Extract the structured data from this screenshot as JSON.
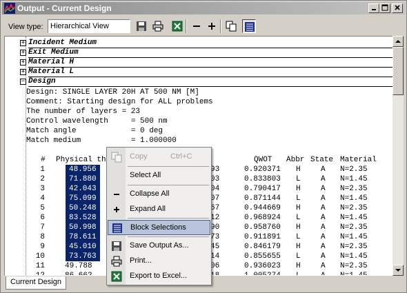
{
  "window": {
    "title": "Output - Current Design"
  },
  "toolbar": {
    "view_type_label": "View type:",
    "view_type_value": "Hierarchical View"
  },
  "sections": [
    {
      "label": "Incident Medium",
      "expanded": false
    },
    {
      "label": "Exit Medium",
      "expanded": false
    },
    {
      "label": "Material H",
      "expanded": false
    },
    {
      "label": "Material L",
      "expanded": false
    },
    {
      "label": "Design",
      "expanded": true
    }
  ],
  "design": {
    "lines": [
      "Design: SINGLE LAYER 20H AT 500 NM [M]",
      "Comment: Starting design for ALL problems",
      "The number of layers = 23",
      "Control wavelength     = 500 nm",
      "Match angle            = 0 deg",
      "Match medium           = 1.000000"
    ],
    "columns": [
      "#",
      "Physical th",
      "QWOT",
      "Abbr",
      "State",
      "Material"
    ],
    "rows": [
      {
        "n": "1",
        "thick": "48.956",
        "frag": "93",
        "qwot": "0.920371",
        "abbr": "H",
        "state": "A",
        "mat": "N=2.35"
      },
      {
        "n": "2",
        "thick": "71.880",
        "frag": "03",
        "qwot": "0.833803",
        "abbr": "L",
        "state": "A",
        "mat": "N=1.45"
      },
      {
        "n": "3",
        "thick": "42.043",
        "frag": "04",
        "qwot": "0.790417",
        "abbr": "H",
        "state": "A",
        "mat": "N=2.35"
      },
      {
        "n": "4",
        "thick": "75.099",
        "frag": "07",
        "qwot": "0.871144",
        "abbr": "L",
        "state": "A",
        "mat": "N=1.45"
      },
      {
        "n": "5",
        "thick": "50.248",
        "frag": "67",
        "qwot": "0.944669",
        "abbr": "H",
        "state": "A",
        "mat": "N=2.35"
      },
      {
        "n": "6",
        "thick": "83.528",
        "frag": "12",
        "qwot": "0.968924",
        "abbr": "L",
        "state": "A",
        "mat": "N=1.45"
      },
      {
        "n": "7",
        "thick": "50.998",
        "frag": "90",
        "qwot": "0.958760",
        "abbr": "H",
        "state": "A",
        "mat": "N=2.35"
      },
      {
        "n": "8",
        "thick": "78.611",
        "frag": "73",
        "qwot": "0.911891",
        "abbr": "L",
        "state": "A",
        "mat": "N=1.45"
      },
      {
        "n": "9",
        "thick": "45.010",
        "frag": "45",
        "qwot": "0.846179",
        "abbr": "H",
        "state": "A",
        "mat": "N=2.35"
      },
      {
        "n": "10",
        "thick": "73.763",
        "frag": "14",
        "qwot": "0.855655",
        "abbr": "L",
        "state": "A",
        "mat": "N=1.45"
      },
      {
        "n": "11",
        "thick": "49.788",
        "frag": "06",
        "qwot": "0.936023",
        "abbr": "H",
        "state": "A",
        "mat": "N=2.35"
      },
      {
        "n": "12",
        "thick": "86.662",
        "frag": "18",
        "qwot": "1.005274",
        "abbr": "L",
        "state": "A",
        "mat": "N=1.45"
      }
    ],
    "selected_rows": 10
  },
  "context_menu": {
    "items": [
      {
        "label": "Copy",
        "shortcut": "Ctrl+C",
        "disabled": true,
        "icon": "copy-icon"
      },
      {
        "label": "Select All",
        "icon": ""
      },
      {
        "label": "Collapse All",
        "icon": "minus-icon"
      },
      {
        "label": "Expand All",
        "icon": "plus-icon"
      },
      {
        "label": "Block Selections",
        "icon": "block-selection-icon",
        "highlighted": true
      },
      {
        "label": "Save Output As...",
        "icon": "save-icon"
      },
      {
        "label": "Print...",
        "icon": "print-icon"
      },
      {
        "label": "Export to Excel...",
        "icon": "excel-icon"
      }
    ]
  },
  "tabs": [
    {
      "label": "Current Design",
      "active": true
    }
  ],
  "colors": {
    "selection": "#0a246a",
    "menu_highlight": "#b8c4da",
    "title_gradient_start": "#8b8b8b"
  }
}
